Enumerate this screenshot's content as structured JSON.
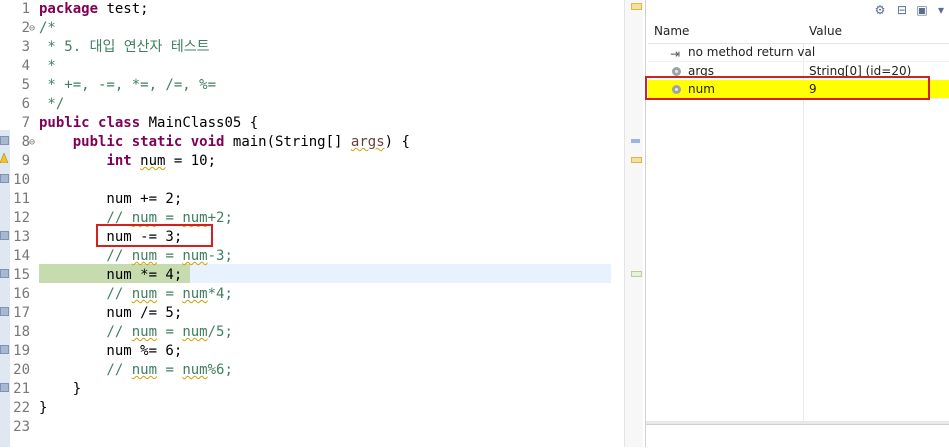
{
  "editor": {
    "lines": [
      {
        "num": "1",
        "fold": "",
        "segs": [
          {
            "t": "package",
            "c": "kw"
          },
          {
            "t": " test;"
          }
        ]
      },
      {
        "num": "2",
        "fold": "⊖",
        "segs": [
          {
            "t": "/*",
            "c": "cm"
          }
        ]
      },
      {
        "num": "3",
        "fold": "",
        "segs": [
          {
            "t": " * 5. 대입 연산자 테스트",
            "c": "cm"
          }
        ]
      },
      {
        "num": "4",
        "fold": "",
        "segs": [
          {
            "t": " *",
            "c": "cm"
          }
        ]
      },
      {
        "num": "5",
        "fold": "",
        "segs": [
          {
            "t": " * +=, -=, *=, /=, %=",
            "c": "cm"
          }
        ]
      },
      {
        "num": "6",
        "fold": "",
        "segs": [
          {
            "t": " */",
            "c": "cm"
          }
        ]
      },
      {
        "num": "7",
        "fold": "",
        "segs": [
          {
            "t": "public",
            "c": "kw"
          },
          {
            "t": " "
          },
          {
            "t": "class",
            "c": "kw"
          },
          {
            "t": " MainClass05 {"
          }
        ]
      },
      {
        "num": "8",
        "fold": "⊖",
        "segs": [
          {
            "t": "    "
          },
          {
            "t": "public",
            "c": "kw"
          },
          {
            "t": " "
          },
          {
            "t": "static",
            "c": "kw"
          },
          {
            "t": " "
          },
          {
            "t": "void",
            "c": "kw"
          },
          {
            "t": " main(String[] "
          },
          {
            "t": "args",
            "c": "sqv"
          },
          {
            "t": ") {"
          }
        ]
      },
      {
        "num": "9",
        "fold": "",
        "segs": [
          {
            "t": "        "
          },
          {
            "t": "int",
            "c": "kw"
          },
          {
            "t": " "
          },
          {
            "t": "num",
            "c": "sq"
          },
          {
            "t": " = 10;"
          }
        ]
      },
      {
        "num": "10",
        "fold": "",
        "segs": []
      },
      {
        "num": "11",
        "fold": "",
        "segs": [
          {
            "t": "        num += 2;"
          }
        ]
      },
      {
        "num": "12",
        "fold": "",
        "segs": [
          {
            "t": "        // ",
            "c": "cm"
          },
          {
            "t": "num",
            "c": "cmsq"
          },
          {
            "t": " = ",
            "c": "cm"
          },
          {
            "t": "num",
            "c": "cmsq"
          },
          {
            "t": "+2;",
            "c": "cm"
          }
        ]
      },
      {
        "num": "13",
        "fold": "",
        "segs": [
          {
            "t": "        num -= 3;"
          }
        ]
      },
      {
        "num": "14",
        "fold": "",
        "segs": [
          {
            "t": "        // ",
            "c": "cm"
          },
          {
            "t": "num",
            "c": "cmsq"
          },
          {
            "t": " = ",
            "c": "cm"
          },
          {
            "t": "num",
            "c": "cmsq"
          },
          {
            "t": "-3;",
            "c": "cm"
          }
        ]
      },
      {
        "num": "15",
        "fold": "",
        "segs": [
          {
            "t": "        num *= 4;"
          }
        ]
      },
      {
        "num": "16",
        "fold": "",
        "segs": [
          {
            "t": "        // ",
            "c": "cm"
          },
          {
            "t": "num",
            "c": "cmsq"
          },
          {
            "t": " = ",
            "c": "cm"
          },
          {
            "t": "num",
            "c": "cmsq"
          },
          {
            "t": "*4;",
            "c": "cm"
          }
        ]
      },
      {
        "num": "17",
        "fold": "",
        "segs": [
          {
            "t": "        num /= 5;"
          }
        ]
      },
      {
        "num": "18",
        "fold": "",
        "segs": [
          {
            "t": "        // ",
            "c": "cm"
          },
          {
            "t": "num",
            "c": "cmsq"
          },
          {
            "t": " = ",
            "c": "cm"
          },
          {
            "t": "num",
            "c": "cmsq"
          },
          {
            "t": "/5;",
            "c": "cm"
          }
        ]
      },
      {
        "num": "19",
        "fold": "",
        "segs": [
          {
            "t": "        num %= 6;"
          }
        ]
      },
      {
        "num": "20",
        "fold": "",
        "segs": [
          {
            "t": "        // ",
            "c": "cm"
          },
          {
            "t": "num",
            "c": "cmsq"
          },
          {
            "t": " = ",
            "c": "cm"
          },
          {
            "t": "num",
            "c": "cmsq"
          },
          {
            "t": "%6;",
            "c": "cm"
          }
        ]
      },
      {
        "num": "21",
        "fold": "",
        "segs": [
          {
            "t": "    }"
          }
        ]
      },
      {
        "num": "22",
        "fold": "",
        "segs": [
          {
            "t": "}"
          }
        ]
      },
      {
        "num": "23",
        "fold": "",
        "segs": []
      }
    ]
  },
  "variables": {
    "columns": {
      "name": "Name",
      "value": "Value"
    },
    "rows": [
      {
        "name": "no method return val",
        "value": "",
        "icon": "return-value-icon"
      },
      {
        "name": "args",
        "value": "String[0]  (id=20)",
        "icon": "local-variable-icon"
      },
      {
        "name": "num",
        "value": "9",
        "icon": "local-variable-icon"
      }
    ]
  },
  "colors": {
    "keyword": "#7f0055",
    "comment": "#3f7f5f",
    "current_line": "#c6dbae",
    "changed_variable": "#ffff00",
    "annotation_box": "#d71f20"
  }
}
